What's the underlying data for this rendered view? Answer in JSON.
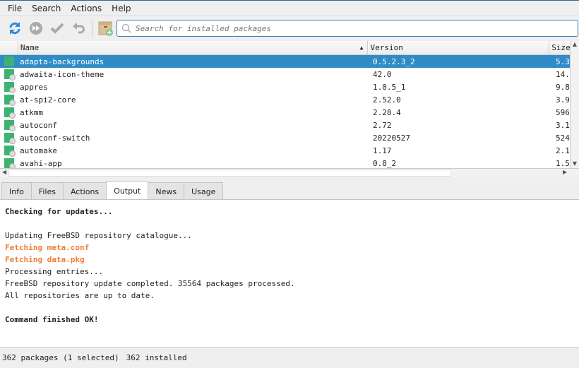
{
  "menu": [
    "File",
    "Search",
    "Actions",
    "Help"
  ],
  "search": {
    "placeholder": "Search for installed packages"
  },
  "columns": {
    "name": "Name",
    "version": "Version",
    "size": "Size"
  },
  "rows": [
    {
      "name": "adapta-backgrounds",
      "version": "0.5.2.3_2",
      "size": "5.3"
    },
    {
      "name": "adwaita-icon-theme",
      "version": "42.0",
      "size": "14."
    },
    {
      "name": "appres",
      "version": "1.0.5_1",
      "size": "9.8"
    },
    {
      "name": "at-spi2-core",
      "version": "2.52.0",
      "size": "3.9"
    },
    {
      "name": "atkmm",
      "version": "2.28.4",
      "size": "596"
    },
    {
      "name": "autoconf",
      "version": "2.72",
      "size": "3.1"
    },
    {
      "name": "autoconf-switch",
      "version": "20220527",
      "size": "524"
    },
    {
      "name": "automake",
      "version": "1.17",
      "size": "2.1"
    },
    {
      "name": "avahi-app",
      "version": "0.8_2",
      "size": "1.5"
    }
  ],
  "tabs": [
    "Info",
    "Files",
    "Actions",
    "Output",
    "News",
    "Usage"
  ],
  "output": [
    {
      "t": "Checking for updates...",
      "s": "b"
    },
    {
      "t": "",
      "s": ""
    },
    {
      "t": "Updating FreeBSD repository catalogue...",
      "s": ""
    },
    {
      "t": "Fetching meta.conf",
      "s": "o"
    },
    {
      "t": "Fetching data.pkg",
      "s": "o"
    },
    {
      "t": "Processing entries...",
      "s": ""
    },
    {
      "t": "FreeBSD repository update completed. 35564 packages processed.",
      "s": ""
    },
    {
      "t": "All repositories are up to date.",
      "s": ""
    },
    {
      "t": "",
      "s": ""
    },
    {
      "t": "Command finished OK!",
      "s": "b"
    }
  ],
  "status": {
    "packages": "362 packages (1 selected)",
    "installed": "362 installed"
  }
}
